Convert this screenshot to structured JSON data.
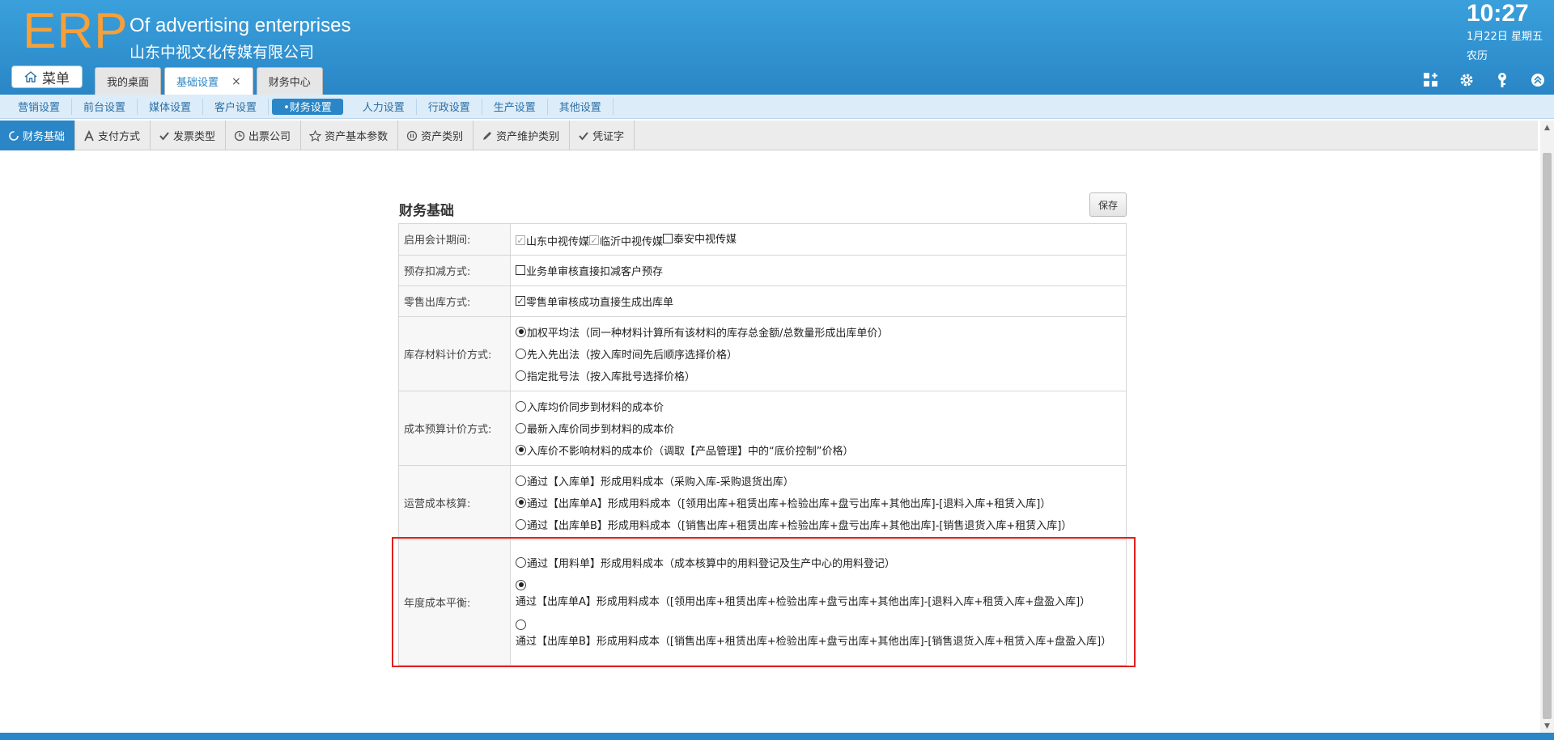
{
  "header": {
    "logo": "ERP",
    "company_en": "Of advertising enterprises",
    "company_cn": "山东中视文化传媒有限公司",
    "time": "10:27",
    "date": "1月22日 星期五",
    "lunar": "农历",
    "menu_label": "菜单",
    "tabs": [
      {
        "label": "我的桌面"
      },
      {
        "label": "基础设置",
        "close": "×"
      },
      {
        "label": "财务中心"
      }
    ]
  },
  "module_nav": [
    "营销设置",
    "前台设置",
    "媒体设置",
    "客户设置",
    "•财务设置",
    "人力设置",
    "行政设置",
    "生产设置",
    "其他设置"
  ],
  "sub_nav": [
    "财务基础",
    "支付方式",
    "发票类型",
    "出票公司",
    "资产基本参数",
    "资产类别",
    "资产维护类别",
    "凭证字"
  ],
  "panel": {
    "title": "财务基础",
    "save_label": "保存",
    "rows": {
      "period": {
        "label": "启用会计期间:",
        "options": [
          {
            "text": "山东中视传媒",
            "checked": true
          },
          {
            "text": "临沂中视传媒",
            "checked": true
          },
          {
            "text": "泰安中视传媒",
            "checked": false
          }
        ]
      },
      "prepay": {
        "label": "预存扣减方式:",
        "option": {
          "text": "业务单审核直接扣减客户预存",
          "checked": false
        }
      },
      "retail": {
        "label": "零售出库方式:",
        "option": {
          "text": "零售单审核成功直接生成出库单",
          "checked": true
        }
      },
      "inventory": {
        "label": "库存材料计价方式:",
        "options": [
          {
            "text": "加权平均法（同一种材料计算所有该材料的库存总金额/总数量形成出库单价）",
            "checked": true
          },
          {
            "text": "先入先出法（按入库时间先后顺序选择价格）",
            "checked": false
          },
          {
            "text": "指定批号法（按入库批号选择价格）",
            "checked": false
          }
        ]
      },
      "budget": {
        "label": "成本预算计价方式:",
        "options": [
          {
            "text": "入库均价同步到材料的成本价",
            "checked": false
          },
          {
            "text": "最新入库价同步到材料的成本价",
            "checked": false
          },
          {
            "text": "入库价不影响材料的成本价（调取【产品管理】中的“底价控制”价格）",
            "checked": true
          }
        ]
      },
      "operating": {
        "label": "运营成本核算:",
        "options": [
          {
            "text": "通过【入库单】形成用料成本（采购入库-采购退货出库）",
            "checked": false
          },
          {
            "text": "通过【出库单A】形成用料成本（[领用出库+租赁出库+检验出库+盘亏出库+其他出库]-[退料入库+租赁入库]）",
            "checked": true
          },
          {
            "text": "通过【出库单B】形成用料成本（[销售出库+租赁出库+检验出库+盘亏出库+其他出库]-[销售退货入库+租赁入库]）",
            "checked": false
          }
        ]
      },
      "annual": {
        "label": "年度成本平衡:",
        "options": [
          {
            "text": "通过【用料单】形成用料成本（成本核算中的用料登记及生产中心的用料登记）",
            "checked": false
          },
          {
            "text": "通过【出库单A】形成用料成本（[领用出库+租赁出库+检验出库+盘亏出库+其他出库]-[退料入库+租赁入库+盘盈入库]）",
            "checked": true
          },
          {
            "text": "通过【出库单B】形成用料成本（[销售出库+租赁出库+检验出库+盘亏出库+其他出库]-[销售退货入库+租赁入库+盘盈入库]）",
            "checked": false
          }
        ]
      }
    }
  }
}
